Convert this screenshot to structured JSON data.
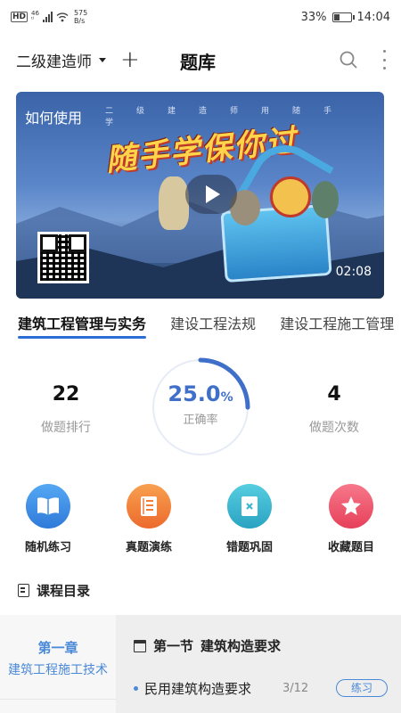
{
  "status_bar": {
    "hd": "HD",
    "network_top": "46",
    "network_bottom": "ᵗˡ",
    "speed_value": "575",
    "speed_unit": "B/s",
    "battery": "33%",
    "time": "14:04",
    "battery_level": 0.33
  },
  "header": {
    "exam_name": "二级建造师",
    "title": "题库"
  },
  "banner": {
    "help_text": "如何使用",
    "strip_text": "二级建造师用随手学",
    "slogan": "随手学保你过",
    "duration": "02:08"
  },
  "subject_tabs": [
    {
      "label": "建筑工程管理与实务",
      "active": true
    },
    {
      "label": "建设工程法规",
      "active": false
    },
    {
      "label": "建设工程施工管理",
      "active": false
    }
  ],
  "stats": {
    "rank_value": "22",
    "rank_label": "做题排行",
    "accuracy_value": "25.0",
    "accuracy_unit": "%",
    "accuracy_label": "正确率",
    "accuracy_fraction": 0.25,
    "count_value": "4",
    "count_label": "做题次数"
  },
  "actions": [
    {
      "label": "随机练习",
      "icon": "book-open-icon",
      "color": "#3b8ee8"
    },
    {
      "label": "真题演练",
      "icon": "document-list-icon",
      "color": "#f07b3a"
    },
    {
      "label": "错题巩固",
      "icon": "wrong-book-icon",
      "color": "#3ab7cf"
    },
    {
      "label": "收藏题目",
      "icon": "star-icon",
      "color": "#ef5a6e"
    }
  ],
  "catalog": {
    "title": "课程目录",
    "chapter_label": "第一章",
    "chapter_name": "建筑工程施工技术",
    "section_label": "第一节",
    "section_name": "建筑构造要求",
    "lesson_name": "民用建筑构造要求",
    "lesson_progress": "3/12",
    "practice_label": "练习"
  },
  "colors": {
    "accent": "#2b6fd6",
    "ring": "#3f6fc8",
    "chapter": "#4a89d8"
  }
}
